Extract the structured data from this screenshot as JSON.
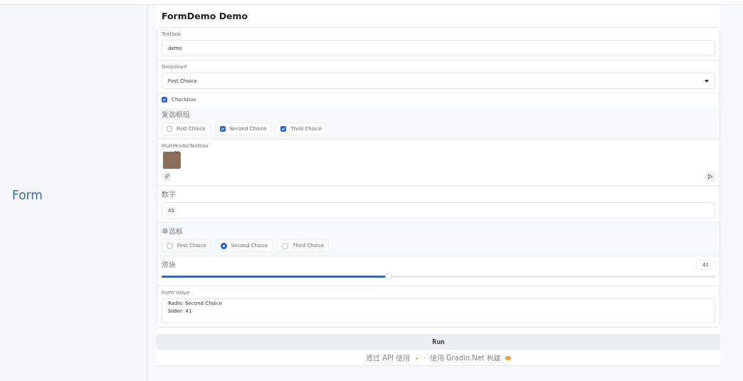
{
  "row_label": "Form",
  "title": "FormDemo Demo",
  "components": [
    {
      "kind": "textbox",
      "label": "Textbox",
      "value": "demo"
    },
    {
      "kind": "dropdown",
      "label": "Dropdown",
      "value": "First Choice"
    },
    {
      "kind": "checkbox",
      "label": "Checkbox",
      "checked": true
    },
    {
      "kind": "checkbox_group",
      "label": "复选框组",
      "options": [
        {
          "label": "First Choice",
          "checked": false
        },
        {
          "label": "Second Choice",
          "checked": true
        },
        {
          "label": "Third Choice",
          "checked": true
        }
      ]
    },
    {
      "kind": "multimodal",
      "label": "MultimodalTextbox"
    },
    {
      "kind": "number",
      "label": "数字",
      "value": "45"
    },
    {
      "kind": "radio",
      "label": "单选框",
      "options": [
        {
          "label": "First Choice",
          "selected": false
        },
        {
          "label": "Second Choice",
          "selected": true
        },
        {
          "label": "Third Choice",
          "selected": false
        }
      ]
    },
    {
      "kind": "slider",
      "label": "滑块",
      "level": 0.41,
      "reading": "41"
    },
    {
      "kind": "textarea",
      "label": "Form Value",
      "lines": [
        "Radio: Second Choice",
        "Slider: 41"
      ]
    }
  ],
  "run_button": "Run",
  "footer": {
    "api_link": "通过 API 使用",
    "separator": "·",
    "built_with": "使用 Gradio.Net 构建"
  }
}
